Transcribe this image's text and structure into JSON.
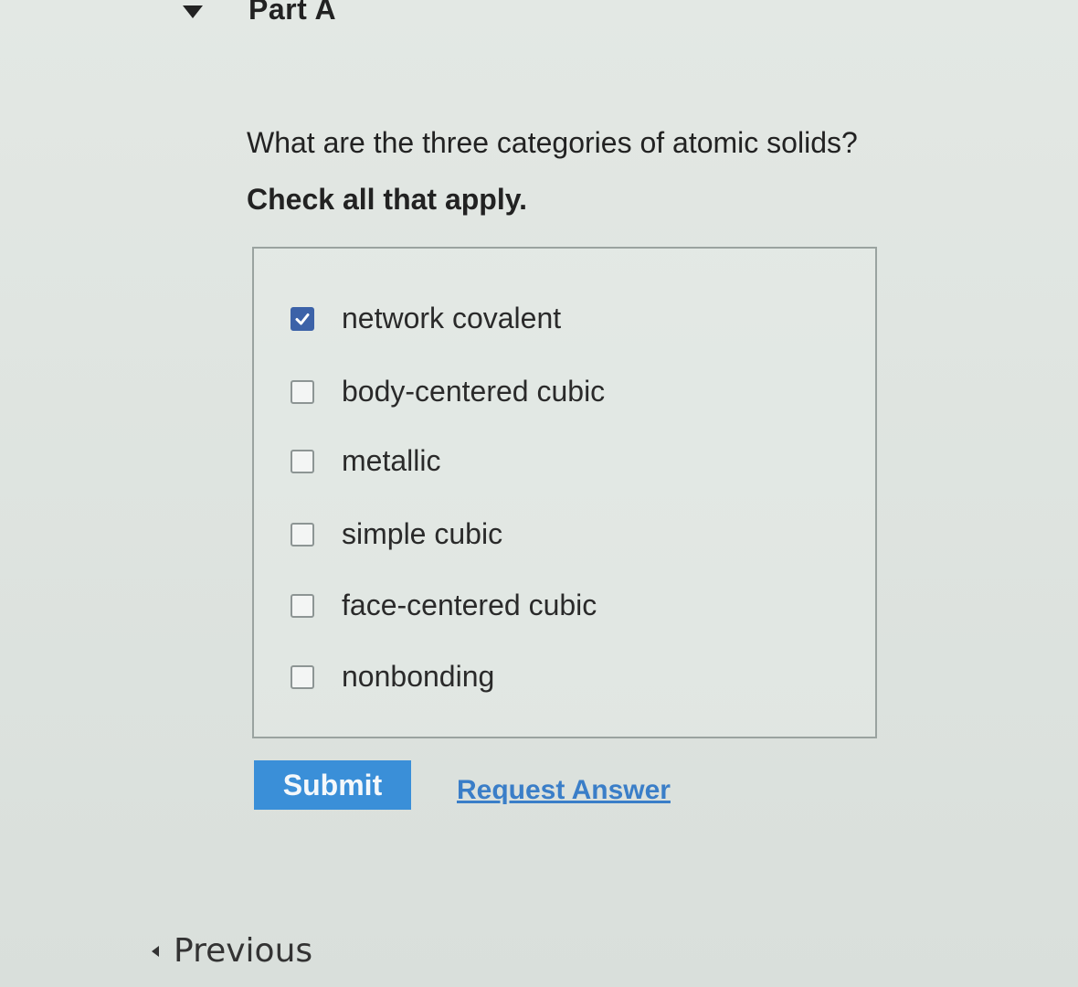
{
  "part": {
    "title": "Part A"
  },
  "question": {
    "prompt": "What are the three categories of atomic solids?",
    "instruction": "Check all that apply."
  },
  "options": [
    {
      "label": "network covalent",
      "checked": true
    },
    {
      "label": "body-centered cubic",
      "checked": false
    },
    {
      "label": "metallic",
      "checked": false
    },
    {
      "label": "simple cubic",
      "checked": false
    },
    {
      "label": "face-centered cubic",
      "checked": false
    },
    {
      "label": "nonbonding",
      "checked": false
    }
  ],
  "actions": {
    "submit_label": "Submit",
    "request_answer_label": "Request Answer"
  },
  "navigation": {
    "previous_label": "Previous"
  },
  "colors": {
    "accent": "#3a8fd8",
    "checkbox_checked": "#3c62a8",
    "link": "#3a7ec8"
  },
  "icons": {
    "collapse": "triangle-down-icon",
    "previous": "chevron-left-icon",
    "check": "checkmark-icon"
  }
}
